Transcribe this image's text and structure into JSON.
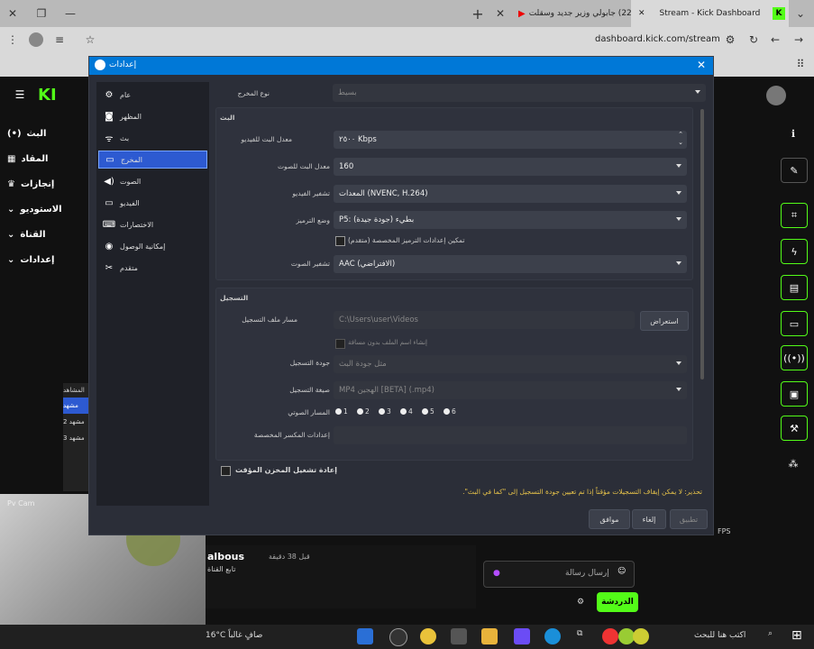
{
  "browser": {
    "tabs": [
      {
        "label": "Stream - Kick Dashboard",
        "active": true
      },
      {
        "label": "(227) جابولي وزير جديد وسقلت",
        "active": false
      }
    ],
    "address": "dashboard.kick.com/stream",
    "new_tab": "+"
  },
  "kick": {
    "sidebar": [
      {
        "label": "البث",
        "icon": "live-icon"
      },
      {
        "label": "المقاد",
        "icon": "chart-icon"
      },
      {
        "label": "إنجازات",
        "icon": "trophy-icon"
      },
      {
        "label": "الاستوديو",
        "icon": "chevron-icon"
      },
      {
        "label": "القناة",
        "icon": "chevron-icon"
      },
      {
        "label": "إعدادات",
        "icon": "chevron-icon"
      }
    ],
    "scenes_header": "المشاهد",
    "scenes": [
      "مشهد",
      "مشهد 2",
      "مشهد 3"
    ],
    "chat": {
      "username": "albous",
      "time": "قبل 38 دقيقة",
      "follow": "تابع القناة",
      "placeholder": "إرسال رسالة",
      "send_label": "الدردشة"
    },
    "fps": "FPS",
    "cam_label": "Pv Cam"
  },
  "dialog": {
    "title": "إعدادات",
    "nav": [
      {
        "label": "عام",
        "icon": "gear-icon"
      },
      {
        "label": "المظهر",
        "icon": "appearance-icon"
      },
      {
        "label": "بث",
        "icon": "antenna-icon"
      },
      {
        "label": "المخرج",
        "icon": "output-icon",
        "active": true
      },
      {
        "label": "الصوت",
        "icon": "speaker-icon"
      },
      {
        "label": "الفيديو",
        "icon": "monitor-icon"
      },
      {
        "label": "الاختصارات",
        "icon": "keyboard-icon"
      },
      {
        "label": "إمكانية الوصول",
        "icon": "accessibility-icon"
      },
      {
        "label": "متقدم",
        "icon": "tools-icon"
      }
    ],
    "output_mode_label": "نوع المخرج",
    "output_mode_value": "بسيط",
    "streaming": {
      "header": "البث",
      "video_bitrate_label": "معدل البت للفيديو",
      "video_bitrate_value": "٢٥٠٠ Kbps",
      "audio_bitrate_label": "معدل البت للصوت",
      "audio_bitrate_value": "160",
      "video_encoder_label": "تشفير الفيديو",
      "video_encoder_value": "المعدات (NVENC, H.264)",
      "encoder_preset_label": "وضع الترميز",
      "encoder_preset_value": "P5: بطيء (جودة جيدة)",
      "custom_encoder_label": "تمكين إعدادات الترميز المخصصة (متقدم)",
      "audio_encoder_label": "تشفير الصوت",
      "audio_encoder_value": "AAC (الافتراضي)"
    },
    "recording": {
      "header": "التسجيل",
      "path_label": "مسار ملف التسجيل",
      "path_value": "C:\\Users\\user\\Videos",
      "browse_label": "استعراض",
      "no_space_label": "إنشاء اسم الملف بدون مسافة",
      "quality_label": "جودة التسجيل",
      "quality_value": "مثل جودة البث",
      "format_label": "صيغة التسجيل",
      "format_value": "MP4 الهجين [BETA] (.mp4)",
      "audio_track_label": "المسار الصوتي",
      "tracks": [
        "1",
        "2",
        "3",
        "4",
        "5",
        "6"
      ],
      "muxer_label": "إعدادات المكسر المخصصة"
    },
    "replay_buffer_label": "إعادة تشغيل المخزن المؤقت",
    "warning": "تحذير: لا يمكن إيقاف التسجيلات مؤقتاً إذا تم تعيين جودة التسجيل إلى \"كما في البث\".",
    "buttons": {
      "ok": "موافق",
      "cancel": "إلغاء",
      "apply": "تطبيق"
    }
  },
  "taskbar": {
    "search_placeholder": "اكتب هنا للبحث",
    "weather": "16°C صافٍ غالباً"
  },
  "colors": {
    "accent": "#0078d7",
    "kick_green": "#53fc18",
    "nav_active": "#2d5ad1"
  }
}
